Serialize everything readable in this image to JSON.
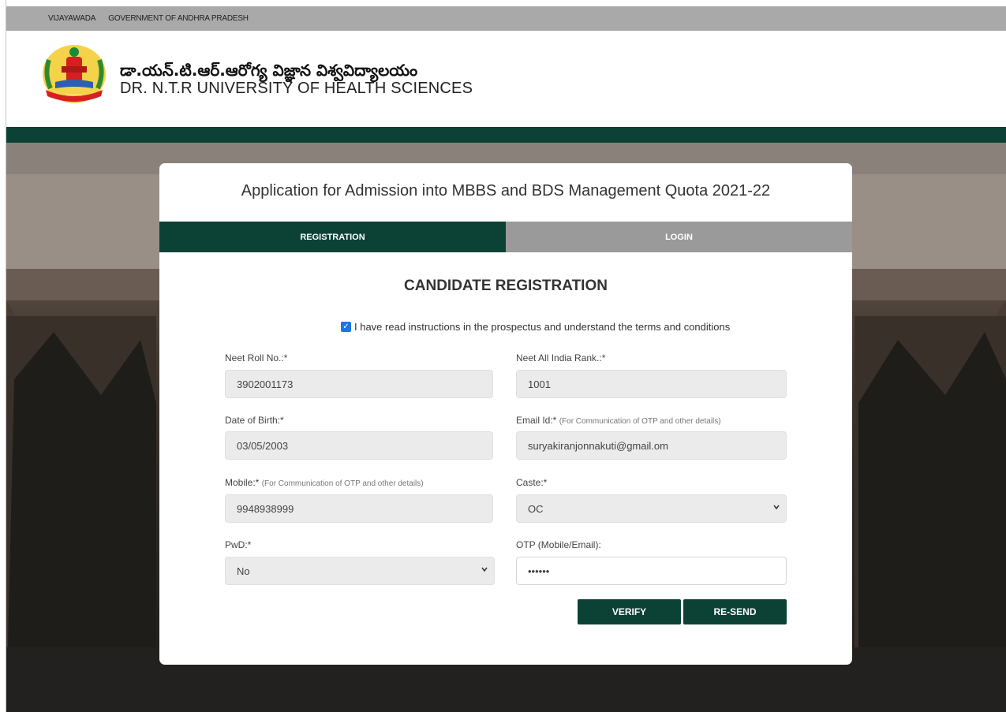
{
  "topbar": {
    "city": "VIJAYAWADA",
    "gov": "GOVERNMENT OF ANDHRA PRADESH"
  },
  "header": {
    "name_telugu": "డా.యన్.టి.ఆర్.ఆరోగ్య విజ్ఞాన విశ్వవిద్యాలయం",
    "name_english": "DR. N.T.R UNIVERSITY OF HEALTH SCIENCES"
  },
  "card": {
    "title": "Application for Admission into MBBS and BDS Management Quota 2021-22",
    "tabs": {
      "registration": "REGISTRATION",
      "login": "LOGIN"
    },
    "section_title": "CANDIDATE REGISTRATION",
    "terms_text": "I have read instructions in the prospectus and understand the terms and conditions",
    "terms_checked": true
  },
  "form": {
    "neet_roll": {
      "label": "Neet Roll No.:*",
      "value": "3902001173"
    },
    "neet_rank": {
      "label": "Neet All India Rank.:*",
      "value": "1001"
    },
    "dob": {
      "label": "Date of Birth:*",
      "value": "03/05/2003"
    },
    "email": {
      "label": "Email Id:*",
      "hint": "(For Communication of OTP and other details)",
      "value": "suryakiranjonnakuti@gmail.om"
    },
    "mobile": {
      "label": "Mobile:*",
      "hint": "(For Communication of OTP and other details)",
      "value": "9948938999"
    },
    "caste": {
      "label": "Caste:*",
      "value": "OC"
    },
    "pwd": {
      "label": "PwD:*",
      "value": "No"
    },
    "otp": {
      "label": "OTP (Mobile/Email):",
      "value": "••••••"
    }
  },
  "buttons": {
    "verify": "VERIFY",
    "resend": "RE-SEND"
  },
  "colors": {
    "primary": "#0c4236",
    "inactive_tab": "#9a9a9a",
    "topbar": "#a9a9a9"
  }
}
